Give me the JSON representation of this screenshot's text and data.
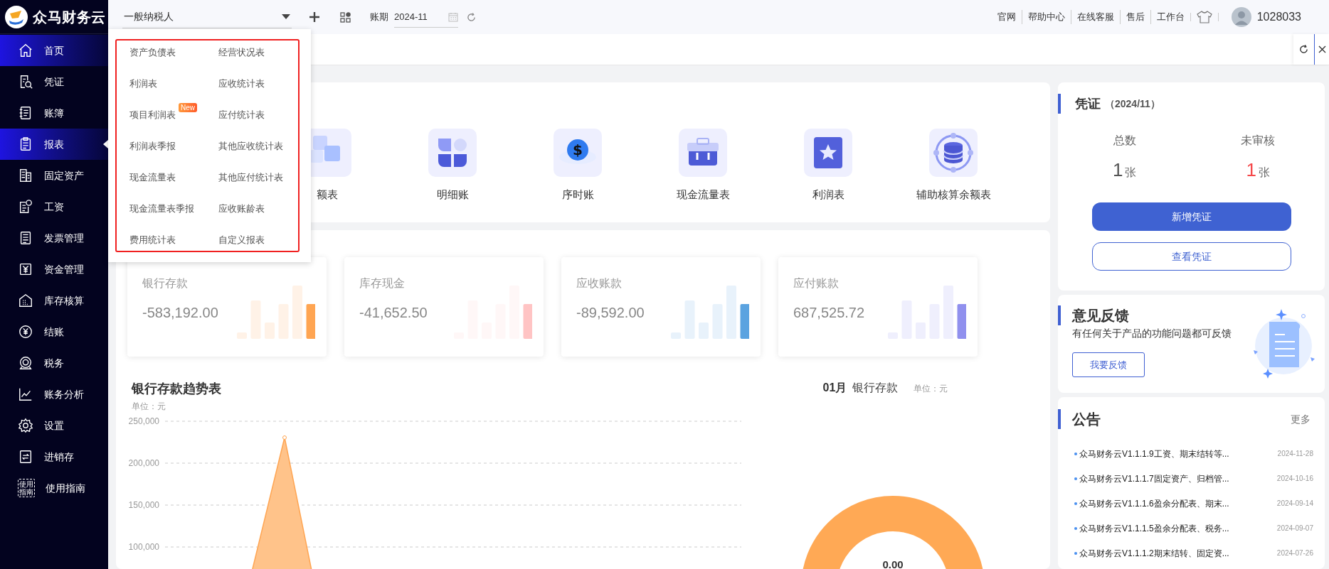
{
  "logo": {
    "text": "众马财务云"
  },
  "sidebar": {
    "items": [
      {
        "kind": "home",
        "label": "首页",
        "selected": true,
        "hovered": false
      },
      {
        "kind": "voucher",
        "label": "凭证",
        "selected": false,
        "hovered": false
      },
      {
        "kind": "ledger",
        "label": "账簿",
        "selected": false,
        "hovered": false
      },
      {
        "kind": "report",
        "label": "报表",
        "selected": true,
        "hovered": true
      },
      {
        "kind": "assets",
        "label": "固定资产",
        "selected": false,
        "hovered": false
      },
      {
        "kind": "salary",
        "label": "工资",
        "selected": false,
        "hovered": false
      },
      {
        "kind": "invoice",
        "label": "发票管理",
        "selected": false,
        "hovered": false
      },
      {
        "kind": "funds",
        "label": "资金管理",
        "selected": false,
        "hovered": false
      },
      {
        "kind": "inventory",
        "label": "库存核算",
        "selected": false,
        "hovered": false
      },
      {
        "kind": "closing",
        "label": "结账",
        "selected": false,
        "hovered": false
      },
      {
        "kind": "tax",
        "label": "税务",
        "selected": false,
        "hovered": false
      },
      {
        "kind": "analysis",
        "label": "账务分析",
        "selected": false,
        "hovered": false
      },
      {
        "kind": "settings",
        "label": "设置",
        "selected": false,
        "hovered": false
      },
      {
        "kind": "stock",
        "label": "进销存",
        "selected": false,
        "hovered": false
      },
      {
        "kind": "guide",
        "label": "使用指南",
        "icon_text": "使用指南",
        "selected": false,
        "hovered": false
      }
    ]
  },
  "topbar": {
    "taxpayer_select": {
      "value": "一般纳税人"
    },
    "period_label": "账期",
    "period_value": "2024-11",
    "links": [
      "官网",
      "帮助中心",
      "在线客服",
      "售后",
      "工作台"
    ],
    "username": "1028033"
  },
  "report_menu": {
    "items": [
      {
        "label": "资产负债表"
      },
      {
        "label": "经营状况表"
      },
      {
        "label": "利润表"
      },
      {
        "label": "应收统计表"
      },
      {
        "label": "项目利润表",
        "badge": "New"
      },
      {
        "label": "应付统计表"
      },
      {
        "label": "利润表季报"
      },
      {
        "label": "其他应收统计表"
      },
      {
        "label": "现金流量表"
      },
      {
        "label": "其他应付统计表"
      },
      {
        "label": "现金流量表季报"
      },
      {
        "label": "应收账龄表"
      },
      {
        "label": "费用统计表"
      },
      {
        "label": "自定义报表"
      }
    ]
  },
  "quick_access": {
    "items": [
      {
        "kind": "cubes",
        "label": "额表"
      },
      {
        "kind": "petals",
        "label": "明细账"
      },
      {
        "kind": "coin",
        "label": "序时账",
        "glyph": "$"
      },
      {
        "kind": "toolbox",
        "label": "现金流量表"
      },
      {
        "kind": "star-book",
        "label": "利润表"
      },
      {
        "kind": "database",
        "label": "辅助核算余额表"
      }
    ]
  },
  "balances": [
    {
      "label": "银行存款",
      "value": "-583,192.00",
      "color": "#ffa552"
    },
    {
      "label": "库存现金",
      "value": "-41,652.50",
      "color": "#ffc4c4"
    },
    {
      "label": "应收账款",
      "value": "-89,592.00",
      "color": "#5ba3e0"
    },
    {
      "label": "应付账款",
      "value": "687,525.72",
      "color": "#9090ee"
    }
  ],
  "trend_chart": {
    "title": "银行存款趋势表",
    "unit": "单位：元",
    "y_axis_labels": [
      "250,000",
      "200,000",
      "150,000",
      "100,000"
    ]
  },
  "donut": {
    "month": "01月",
    "account": "银行存款",
    "unit": "单位：元",
    "center_value": "0.00"
  },
  "voucher": {
    "title": "凭证",
    "period": "（2024/11）",
    "stats": [
      {
        "label": "总数",
        "value": "1",
        "unit": "张",
        "alert": false
      },
      {
        "label": "未审核",
        "value": "1",
        "unit": "张",
        "alert": true
      }
    ],
    "buttons": [
      {
        "label": "新增凭证",
        "primary": true
      },
      {
        "label": "查看凭证",
        "primary": false
      }
    ]
  },
  "feedback": {
    "title": "意见反馈",
    "text": "有任何关于产品的功能问题都可反馈",
    "button": "我要反馈"
  },
  "notices": {
    "title": "公告",
    "more": "更多",
    "items": [
      {
        "text": "众马财务云V1.1.1.9工资、期末结转等...",
        "date": "2024-11-28"
      },
      {
        "text": "众马财务云V1.1.1.7固定资产、归档管...",
        "date": "2024-10-16"
      },
      {
        "text": "众马财务云V1.1.1.6盈余分配表、期末...",
        "date": "2024-09-14"
      },
      {
        "text": "众马财务云V1.1.1.5盈余分配表、税务...",
        "date": "2024-09-07"
      },
      {
        "text": "众马财务云V1.1.1.2期末结转、固定资...",
        "date": "2024-07-26"
      }
    ]
  }
}
